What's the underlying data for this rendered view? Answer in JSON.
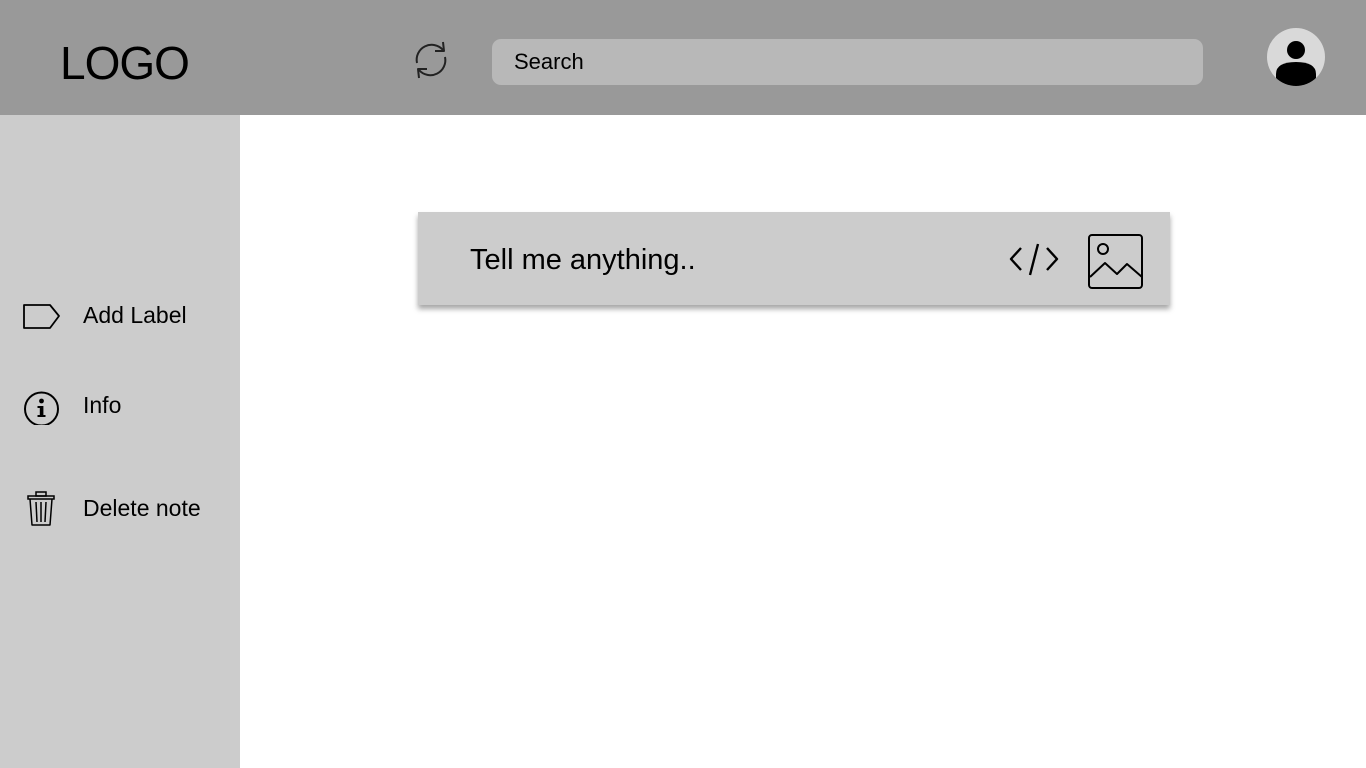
{
  "header": {
    "logo_text": "LOGO",
    "refresh_icon": "refresh-icon",
    "search": {
      "placeholder": "Search",
      "value": ""
    },
    "avatar_icon": "user-avatar-icon"
  },
  "sidebar": {
    "items": [
      {
        "label": "Add Label",
        "icon": "label-tag-icon"
      },
      {
        "label": "Info",
        "icon": "info-icon"
      },
      {
        "label": "Delete note",
        "icon": "trash-icon"
      }
    ]
  },
  "composer": {
    "placeholder": "Tell me anything..",
    "value": "",
    "code_icon": "code-icon",
    "image_icon": "image-icon"
  },
  "colors": {
    "header_bg": "#999999",
    "sidebar_bg": "#cccccc",
    "search_bg": "#b8b8b8",
    "composer_bg": "#cccccc",
    "content_bg": "#ffffff"
  }
}
